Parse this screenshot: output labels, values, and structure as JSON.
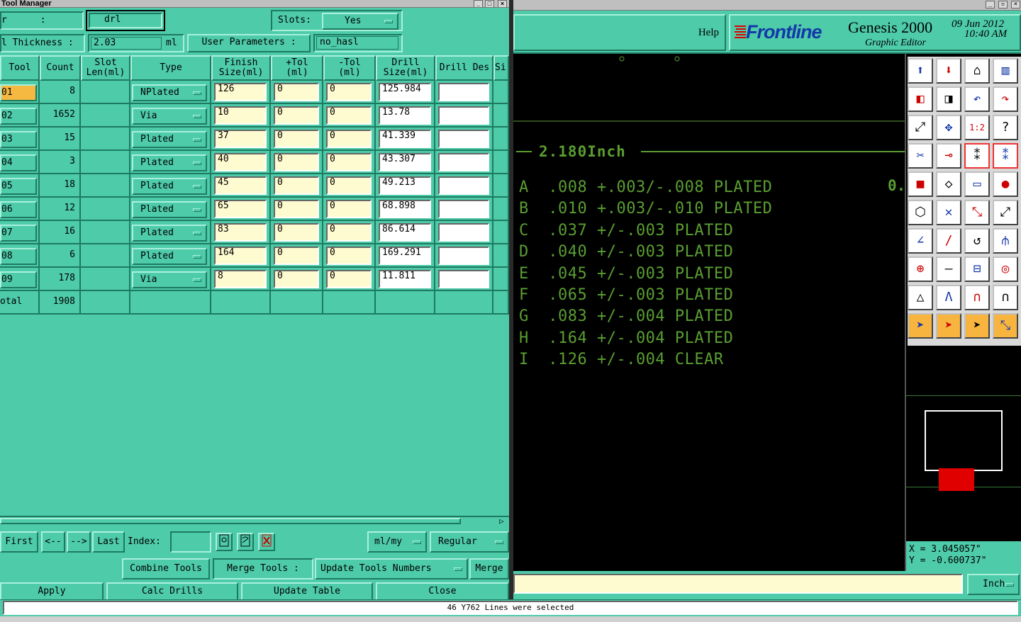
{
  "tool_manager": {
    "title": "Tool Manager",
    "layer_label": "r      :",
    "layer_value": "drl",
    "slots_label": "Slots:",
    "slots_value": "Yes",
    "thickness_label": "l Thickness :",
    "thickness_value": "2.03",
    "thickness_unit": "ml",
    "user_params_label": "User Parameters :",
    "user_params_value": "no_hasl",
    "columns": [
      "Tool",
      "Count",
      "Slot Len(ml)",
      "Type",
      "Finish Size(ml)",
      "+Tol (ml)",
      "-Tol (ml)",
      "Drill Size(ml)",
      "Drill Des",
      "Si"
    ],
    "rows": [
      {
        "tool": "01",
        "count": "8",
        "type": "NPlated",
        "finish": "126",
        "ptol": "0",
        "mtol": "0",
        "drill": "125.984",
        "des": ""
      },
      {
        "tool": "02",
        "count": "1652",
        "type": "Via",
        "finish": "10",
        "ptol": "0",
        "mtol": "0",
        "drill": "13.78",
        "des": ""
      },
      {
        "tool": "03",
        "count": "15",
        "type": "Plated",
        "finish": "37",
        "ptol": "0",
        "mtol": "0",
        "drill": "41.339",
        "des": ""
      },
      {
        "tool": "04",
        "count": "3",
        "type": "Plated",
        "finish": "40",
        "ptol": "0",
        "mtol": "0",
        "drill": "43.307",
        "des": ""
      },
      {
        "tool": "05",
        "count": "18",
        "type": "Plated",
        "finish": "45",
        "ptol": "0",
        "mtol": "0",
        "drill": "49.213",
        "des": ""
      },
      {
        "tool": "06",
        "count": "12",
        "type": "Plated",
        "finish": "65",
        "ptol": "0",
        "mtol": "0",
        "drill": "68.898",
        "des": ""
      },
      {
        "tool": "07",
        "count": "16",
        "type": "Plated",
        "finish": "83",
        "ptol": "0",
        "mtol": "0",
        "drill": "86.614",
        "des": ""
      },
      {
        "tool": "08",
        "count": "6",
        "type": "Plated",
        "finish": "164",
        "ptol": "0",
        "mtol": "0",
        "drill": "169.291",
        "des": ""
      },
      {
        "tool": "09",
        "count": "178",
        "type": "Via",
        "finish": "8",
        "ptol": "0",
        "mtol": "0",
        "drill": "11.811",
        "des": ""
      }
    ],
    "total_label": "otal",
    "total_count": "1908",
    "nav": {
      "first": "First",
      "prev": "<--",
      "next": "-->",
      "last": "Last",
      "index_label": "Index:",
      "units": "ml/my",
      "mode": "Regular"
    },
    "actions": {
      "combine": "Combine Tools",
      "merge_label": "Merge Tools :",
      "update_numbers": "Update Tools Numbers",
      "merge": "Merge"
    },
    "bottom": {
      "apply": "Apply",
      "calc": "Calc Drills",
      "update_table": "Update Table",
      "close": "Close"
    }
  },
  "editor": {
    "help": "Help",
    "brand": "Frontline",
    "product": "Genesis 2000",
    "subtitle": "Graphic Editor",
    "date": "09 Jun 2012",
    "time": "10:40 AM",
    "dimension": "2.180Inch",
    "edge_text": "0.",
    "legend": [
      "A  .008 +.003/-.008 PLATED",
      "B  .010 +.003/-.010 PLATED",
      "C  .037 +/-.003 PLATED",
      "D  .040 +/-.003 PLATED",
      "E  .045 +/-.003 PLATED",
      "F  .065 +/-.003 PLATED",
      "G  .083 +/-.004 PLATED",
      "H  .164 +/-.004 PLATED",
      "I  .126 +/-.004 CLEAR"
    ],
    "coord_x": "X = 3.045057\"",
    "coord_y": "Y = -0.600737\"",
    "units": "Inch",
    "status": "46 Y762 Lines were selected"
  },
  "colors": {
    "teal": "#4ecba9",
    "legend_green": "#5a9e32",
    "highlight": "#f5b942",
    "red": "#e00000"
  }
}
